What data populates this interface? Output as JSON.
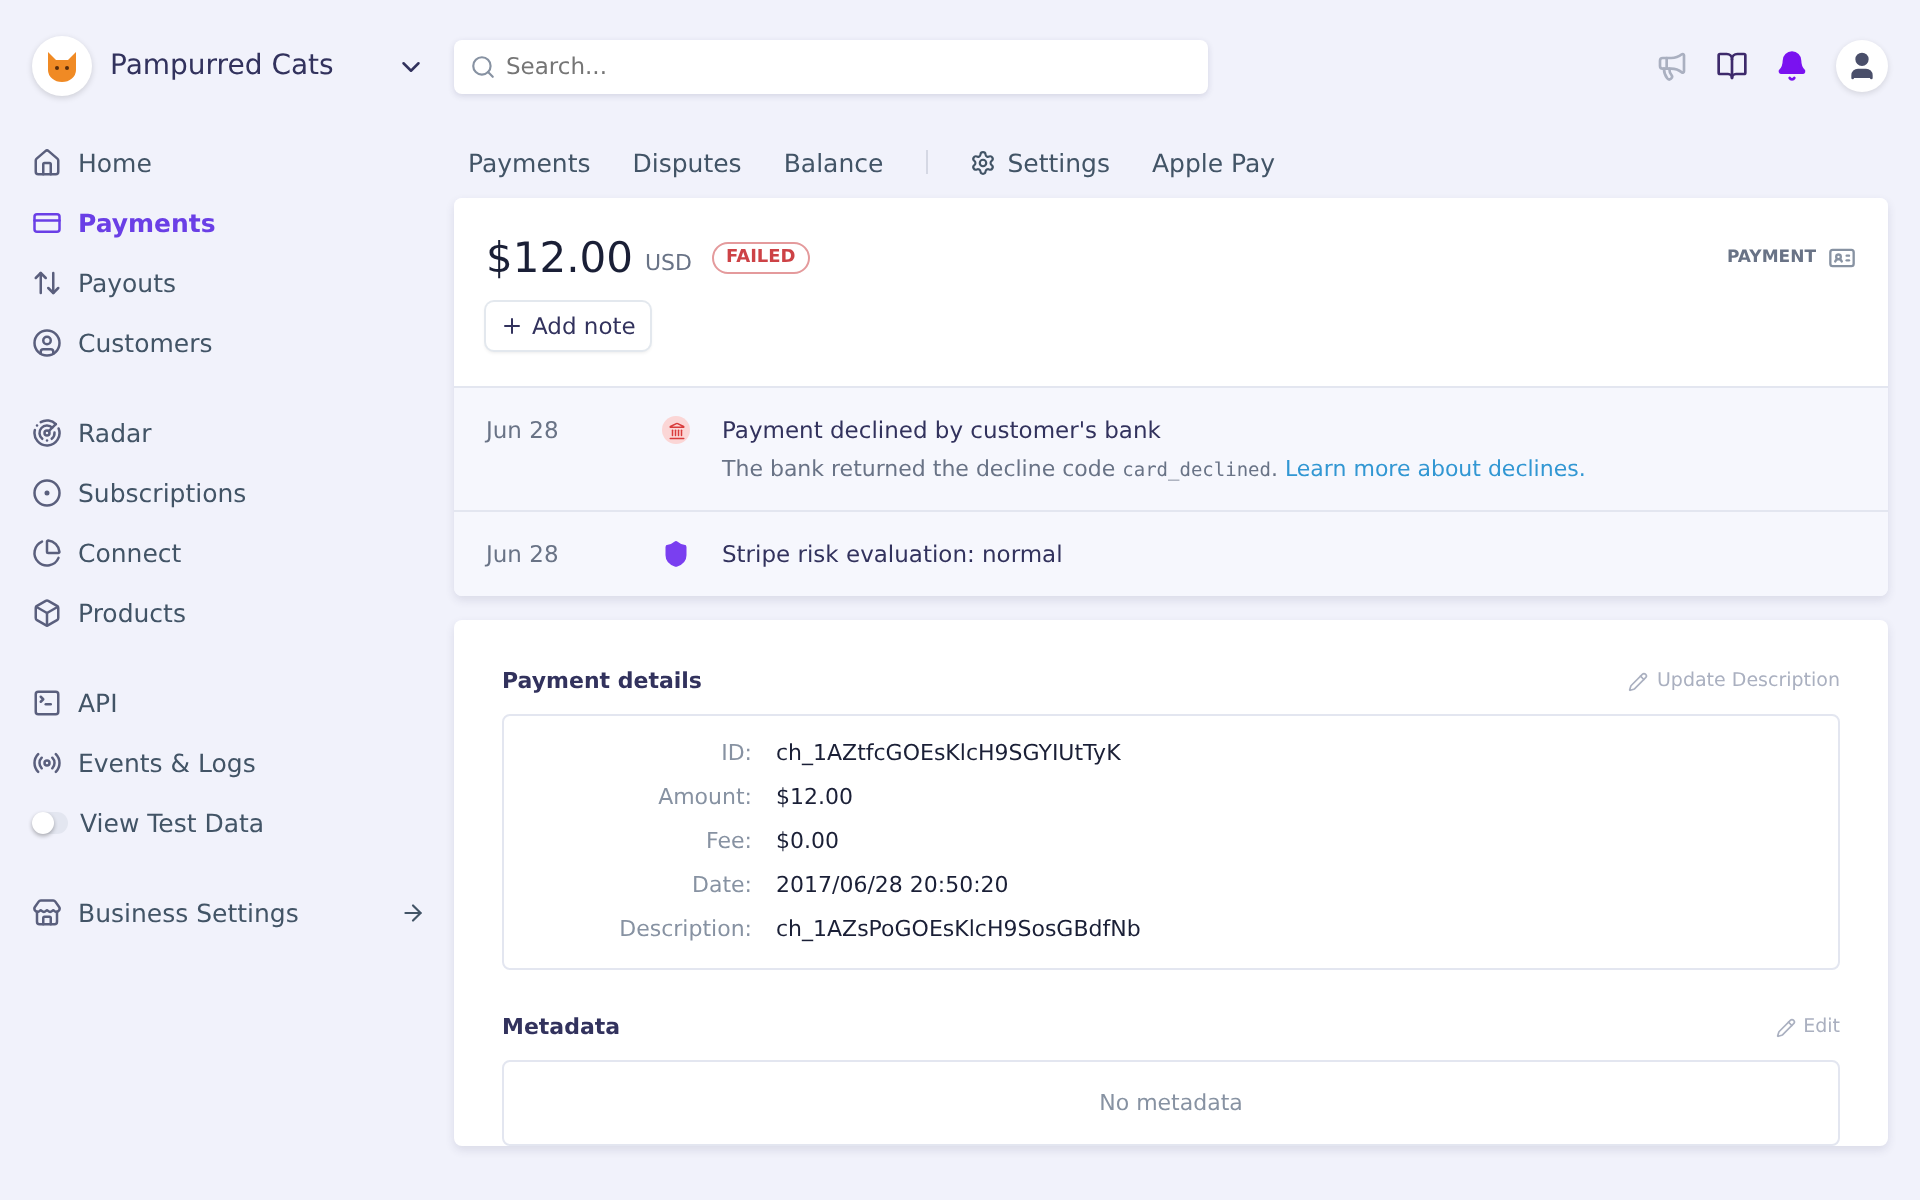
{
  "account": {
    "name": "Pampurred Cats"
  },
  "search": {
    "placeholder": "Search..."
  },
  "sidebar": {
    "groups": [
      [
        {
          "kind": "home",
          "label": "Home",
          "selected": false
        },
        {
          "kind": "payments",
          "label": "Payments",
          "selected": true
        },
        {
          "kind": "payouts",
          "label": "Payouts",
          "selected": false
        },
        {
          "kind": "customers",
          "label": "Customers",
          "selected": false
        }
      ],
      [
        {
          "kind": "radar",
          "label": "Radar",
          "selected": false
        },
        {
          "kind": "subscriptions",
          "label": "Subscriptions",
          "selected": false
        },
        {
          "kind": "connect",
          "label": "Connect",
          "selected": false
        },
        {
          "kind": "products",
          "label": "Products",
          "selected": false
        }
      ],
      [
        {
          "kind": "api",
          "label": "API",
          "selected": false
        },
        {
          "kind": "events",
          "label": "Events & Logs",
          "selected": false
        },
        {
          "kind": "toggle",
          "label": "View Test Data",
          "on": false
        }
      ],
      [
        {
          "kind": "business",
          "label": "Business Settings",
          "selected": false
        }
      ]
    ]
  },
  "tabs": [
    {
      "kind": "link",
      "label": "Payments"
    },
    {
      "kind": "link",
      "label": "Disputes"
    },
    {
      "kind": "link",
      "label": "Balance"
    },
    {
      "kind": "settings",
      "label": "Settings"
    },
    {
      "kind": "link",
      "label": "Apple Pay"
    }
  ],
  "payment": {
    "amount": "$12.00",
    "currency": "USD",
    "status": "FAILED",
    "type_label": "PAYMENT",
    "add_note": "Add note"
  },
  "timeline": [
    {
      "kind": "declined",
      "date": "Jun 28",
      "title": "Payment declined by customer's bank",
      "detail": {
        "text": "The bank returned the decline code",
        "code": "card_declined",
        "after": ".",
        "link": "Learn more about declines."
      }
    },
    {
      "kind": "risk",
      "date": "Jun 28",
      "title": "Stripe risk evaluation: normal"
    }
  ],
  "details": {
    "title": "Payment details",
    "action": "Update Description",
    "rows": [
      {
        "label": "ID:",
        "value": "ch_1AZtfcGOEsKlcH9SGYIUtTyK"
      },
      {
        "label": "Amount:",
        "value": "$12.00"
      },
      {
        "label": "Fee:",
        "value": "$0.00"
      },
      {
        "label": "Date:",
        "value": "2017/06/28 20:50:20"
      },
      {
        "label": "Description:",
        "value": "ch_1AZsPoGOEsKlcH9SosGBdfNb"
      }
    ]
  },
  "metadata": {
    "title": "Metadata",
    "action": "Edit",
    "empty": "No metadata"
  }
}
